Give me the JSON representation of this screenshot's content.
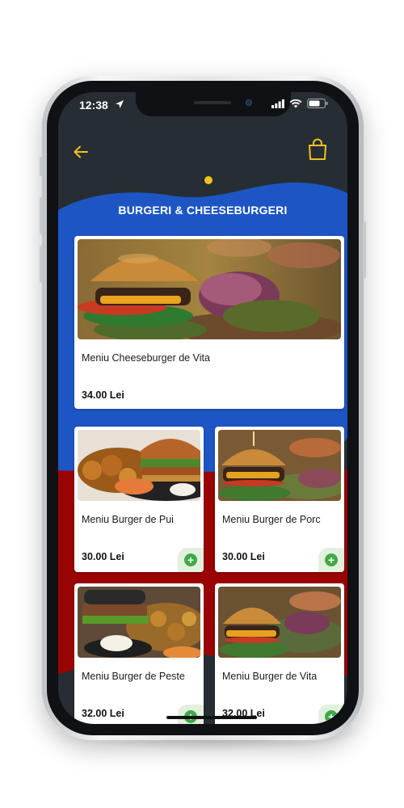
{
  "status_bar": {
    "time": "12:38"
  },
  "header": {
    "back_icon": "arrow-left-icon",
    "cart_icon": "shopping-bag-icon"
  },
  "category": {
    "title": "BURGERI & CHEESEBURGERI"
  },
  "products": [
    {
      "name": "Meniu Cheeseburger de Vita",
      "price": "34.00 Lei"
    },
    {
      "name": "Meniu Burger de Pui",
      "price": "30.00 Lei"
    },
    {
      "name": "Meniu Burger de Porc",
      "price": "30.00 Lei"
    },
    {
      "name": "Meniu Burger de Peste",
      "price": "32.00 Lei"
    },
    {
      "name": "Meniu Burger de Vita",
      "price": "32.00 Lei"
    }
  ],
  "colors": {
    "background": "#262d33",
    "blue_wave": "#1d56c4",
    "red_wave": "#9a0404",
    "accent_yellow": "#f2c21b",
    "add_green": "#3faa45"
  }
}
